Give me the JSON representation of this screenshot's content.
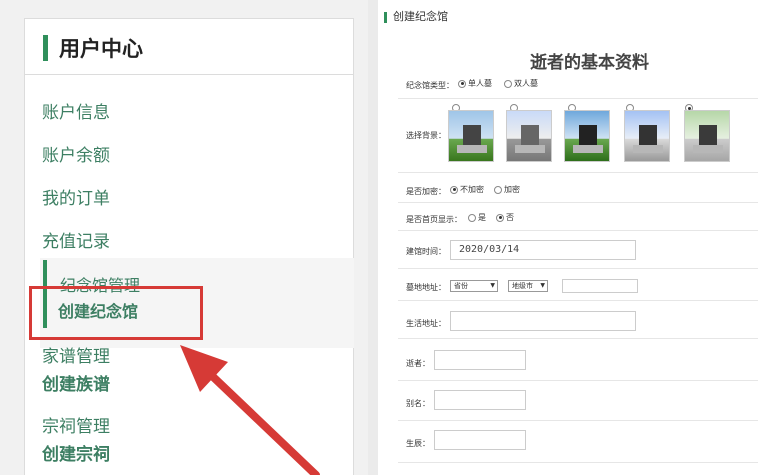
{
  "sidebar": {
    "title": "用户中心",
    "items": [
      {
        "label": "账户信息"
      },
      {
        "label": "账户余额"
      },
      {
        "label": "我的订单"
      },
      {
        "label": "充值记录"
      }
    ],
    "memorial": {
      "group": "纪念馆管理",
      "create": "创建纪念馆"
    },
    "genealogy": {
      "group": "家谱管理",
      "create": "创建族谱"
    },
    "ancestral": {
      "group": "宗祠管理",
      "create": "创建宗祠"
    }
  },
  "form": {
    "page_title": "创建纪念馆",
    "heading": "逝者的基本资料",
    "type_label": "纪念馆类型：",
    "type_options": [
      "单人墓",
      "双人墓"
    ],
    "type_selected": "单人墓",
    "bg_label": "选择背景：",
    "encrypt_label": "是否加密：",
    "encrypt_options": [
      "不加密",
      "加密"
    ],
    "homepage_label": "是否首页显示：",
    "homepage_options": [
      "是",
      "否"
    ],
    "build_time_label": "建馆时间：",
    "build_time_value": "2020/03/14",
    "cemetery_label": "墓地地址：",
    "province_select": "省份",
    "city_select": "地级市",
    "living_label": "生活地址：",
    "deceased_label": "逝者：",
    "alias_label": "别名：",
    "birthday_label": "生辰："
  },
  "colors": {
    "accent": "#2f8f5b",
    "highlight": "#d63a36"
  }
}
